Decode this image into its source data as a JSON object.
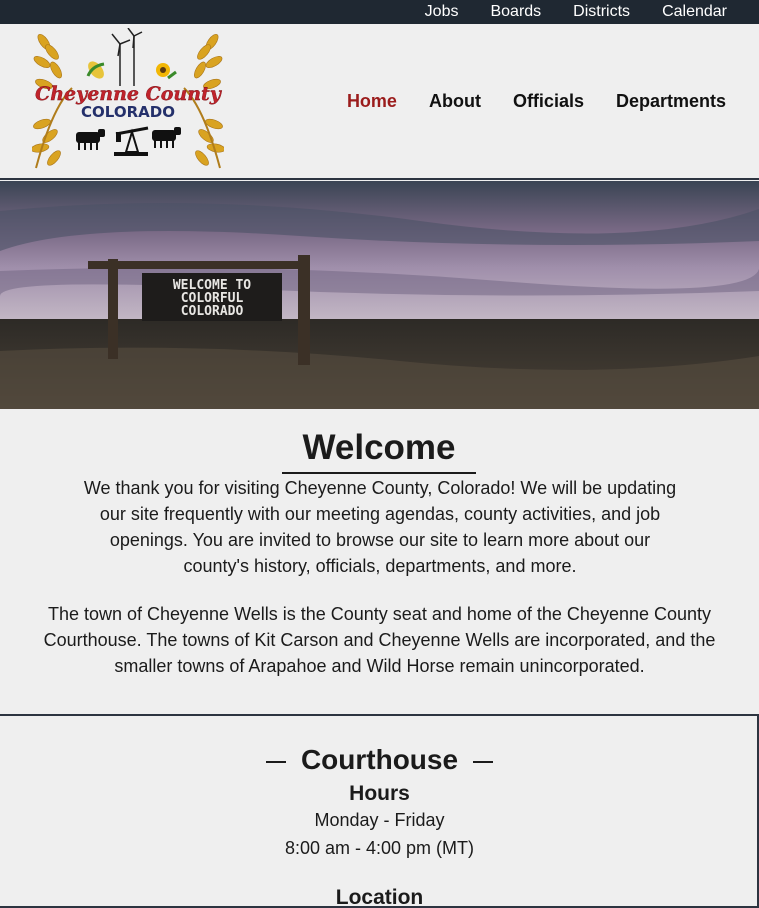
{
  "top_nav": {
    "items": [
      "Jobs",
      "Boards",
      "Districts",
      "Calendar"
    ]
  },
  "logo": {
    "line1": "Cheyenne County",
    "line2": "COLORADO"
  },
  "main_nav": {
    "items": [
      "Home",
      "About",
      "Officials",
      "Departments"
    ],
    "active": "Home"
  },
  "hero": {
    "sign_line1": "WELCOME TO",
    "sign_line2": "COLORFUL",
    "sign_line3": "COLORADO"
  },
  "welcome": {
    "title": "Welcome",
    "paragraph1": "We thank you for visiting Cheyenne County, Colorado! We will be updating our site frequently with our meeting agendas, county activities, and job openings. You are invited to browse our site to learn more about our county's history, officials, departments, and more.",
    "paragraph2": "The town of Cheyenne Wells is the County seat and home of the Cheyenne County Courthouse. The towns of Kit Carson and Cheyenne Wells are incorporated, and the smaller towns of Arapahoe and Wild Horse remain unincorporated."
  },
  "courthouse": {
    "title": "Courthouse",
    "hours_title": "Hours",
    "days": "Monday - Friday",
    "times": "8:00 am - 4:00 pm (MT)",
    "location_title": "Location"
  },
  "colors": {
    "top_bar": "#1f2832",
    "active_nav": "#9b1c1c",
    "background": "#efefef",
    "logo_red": "#c0232b",
    "logo_navy": "#24306b"
  }
}
